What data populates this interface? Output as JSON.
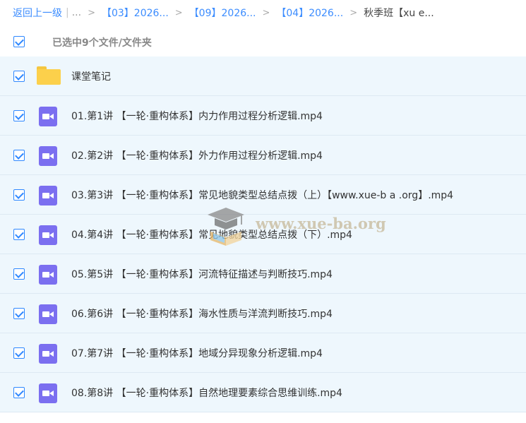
{
  "breadcrumb": {
    "back_label": "返回上一级",
    "separator": "|",
    "ellipsis": "...",
    "arrow": ">",
    "crumbs": [
      "【03】2026...",
      "【09】2026...",
      "【04】2026..."
    ],
    "current": "秋季班【xu e..."
  },
  "selection": {
    "label": "已选中9个文件/文件夹",
    "all_checked": true
  },
  "files": [
    {
      "type": "folder",
      "name": "课堂笔记",
      "checked": true
    },
    {
      "type": "video",
      "name": "01.第1讲 【一轮·重构体系】内力作用过程分析逻辑.mp4",
      "checked": true
    },
    {
      "type": "video",
      "name": "02.第2讲 【一轮·重构体系】外力作用过程分析逻辑.mp4",
      "checked": true
    },
    {
      "type": "video",
      "name": "03.第3讲 【一轮·重构体系】常见地貌类型总结点拨（上）【www.xue-b a .org】.mp4",
      "checked": true
    },
    {
      "type": "video",
      "name": "04.第4讲 【一轮·重构体系】常见地貌类型总结点拨（下）.mp4",
      "checked": true
    },
    {
      "type": "video",
      "name": "05.第5讲 【一轮·重构体系】河流特征描述与判断技巧.mp4",
      "checked": true
    },
    {
      "type": "video",
      "name": "06.第6讲 【一轮·重构体系】海水性质与洋流判断技巧.mp4",
      "checked": true
    },
    {
      "type": "video",
      "name": "07.第7讲 【一轮·重构体系】地域分异现象分析逻辑.mp4",
      "checked": true
    },
    {
      "type": "video",
      "name": "08.第8讲 【一轮·重构体系】自然地理要素综合思维训练.mp4",
      "checked": true
    }
  ],
  "watermark": {
    "text": "www.xue-ba.org",
    "icon": "graduation-cap-book-icon"
  },
  "colors": {
    "link": "#3b8cff",
    "checkbox": "#2f88ff",
    "row_bg": "#eef7fd",
    "folder": "#fcd04b",
    "video": "#7b6ff0"
  }
}
